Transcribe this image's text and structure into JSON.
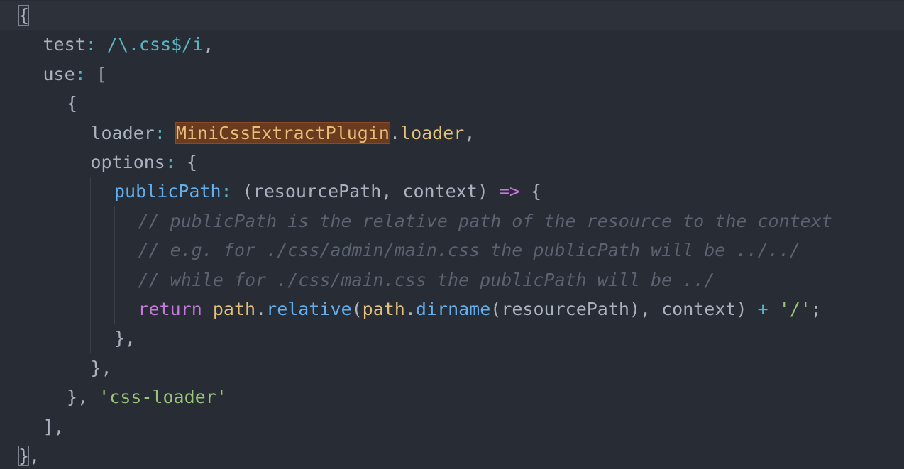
{
  "editor": {
    "lines": [
      {
        "indent": 0,
        "tokens": [
          {
            "t": "{",
            "c": "punc",
            "match": true
          }
        ]
      },
      {
        "indent": 1,
        "tokens": [
          {
            "t": "test",
            "c": "prop"
          },
          {
            "t": ": ",
            "c": "op"
          },
          {
            "t": "/\\.css$/i",
            "c": "regex"
          },
          {
            "t": ",",
            "c": "punc"
          }
        ]
      },
      {
        "indent": 1,
        "tokens": [
          {
            "t": "use",
            "c": "prop"
          },
          {
            "t": ": ",
            "c": "op"
          },
          {
            "t": "[",
            "c": "punc"
          }
        ]
      },
      {
        "indent": 2,
        "tokens": [
          {
            "t": "{",
            "c": "punc"
          }
        ]
      },
      {
        "indent": 3,
        "tokens": [
          {
            "t": "loader",
            "c": "prop"
          },
          {
            "t": ": ",
            "c": "op"
          },
          {
            "t": "MiniCssExtractPlugin",
            "c": "class",
            "highlight": true
          },
          {
            "t": ".",
            "c": "punc"
          },
          {
            "t": "loader",
            "c": "obj"
          },
          {
            "t": ",",
            "c": "punc"
          }
        ]
      },
      {
        "indent": 3,
        "tokens": [
          {
            "t": "options",
            "c": "prop"
          },
          {
            "t": ": ",
            "c": "op"
          },
          {
            "t": "{",
            "c": "punc"
          }
        ]
      },
      {
        "indent": 4,
        "tokens": [
          {
            "t": "publicPath",
            "c": "fn-prop"
          },
          {
            "t": ": ",
            "c": "op"
          },
          {
            "t": "(resourcePath, context) ",
            "c": "punc"
          },
          {
            "t": "=>",
            "c": "kw"
          },
          {
            "t": " {",
            "c": "punc"
          }
        ]
      },
      {
        "indent": 5,
        "tokens": [
          {
            "t": "// publicPath is the relative path of the resource to the context",
            "c": "comment"
          }
        ]
      },
      {
        "indent": 5,
        "tokens": [
          {
            "t": "// e.g. for ./css/admin/main.css the publicPath will be ../../",
            "c": "comment"
          }
        ]
      },
      {
        "indent": 5,
        "tokens": [
          {
            "t": "// while for ./css/main.css the publicPath will be ../",
            "c": "comment"
          }
        ]
      },
      {
        "indent": 5,
        "tokens": [
          {
            "t": "return",
            "c": "kw"
          },
          {
            "t": " ",
            "c": "punc"
          },
          {
            "t": "path",
            "c": "obj"
          },
          {
            "t": ".",
            "c": "punc"
          },
          {
            "t": "relative",
            "c": "fn-prop"
          },
          {
            "t": "(",
            "c": "punc"
          },
          {
            "t": "path",
            "c": "obj"
          },
          {
            "t": ".",
            "c": "punc"
          },
          {
            "t": "dirname",
            "c": "fn-prop"
          },
          {
            "t": "(resourcePath), context) ",
            "c": "punc"
          },
          {
            "t": "+",
            "c": "op"
          },
          {
            "t": " ",
            "c": "punc"
          },
          {
            "t": "'/'",
            "c": "str"
          },
          {
            "t": ";",
            "c": "punc"
          }
        ]
      },
      {
        "indent": 4,
        "tokens": [
          {
            "t": "},",
            "c": "punc"
          }
        ]
      },
      {
        "indent": 3,
        "tokens": [
          {
            "t": "},",
            "c": "punc"
          }
        ]
      },
      {
        "indent": 2,
        "tokens": [
          {
            "t": "}, ",
            "c": "punc"
          },
          {
            "t": "'css-loader'",
            "c": "str"
          }
        ]
      },
      {
        "indent": 1,
        "tokens": [
          {
            "t": "],",
            "c": "punc"
          }
        ]
      },
      {
        "indent": 0,
        "tokens": [
          {
            "t": "}",
            "c": "punc",
            "match": true
          },
          {
            "t": ",",
            "c": "punc"
          }
        ]
      }
    ]
  },
  "colors": {
    "background": "#282c34",
    "current_line": "#2c313a",
    "highlight": "#6b3a1f",
    "string": "#98c379",
    "keyword": "#c678dd",
    "function": "#61afef",
    "class": "#e5c07b",
    "comment": "#5c6370",
    "operator": "#56b6c2"
  }
}
